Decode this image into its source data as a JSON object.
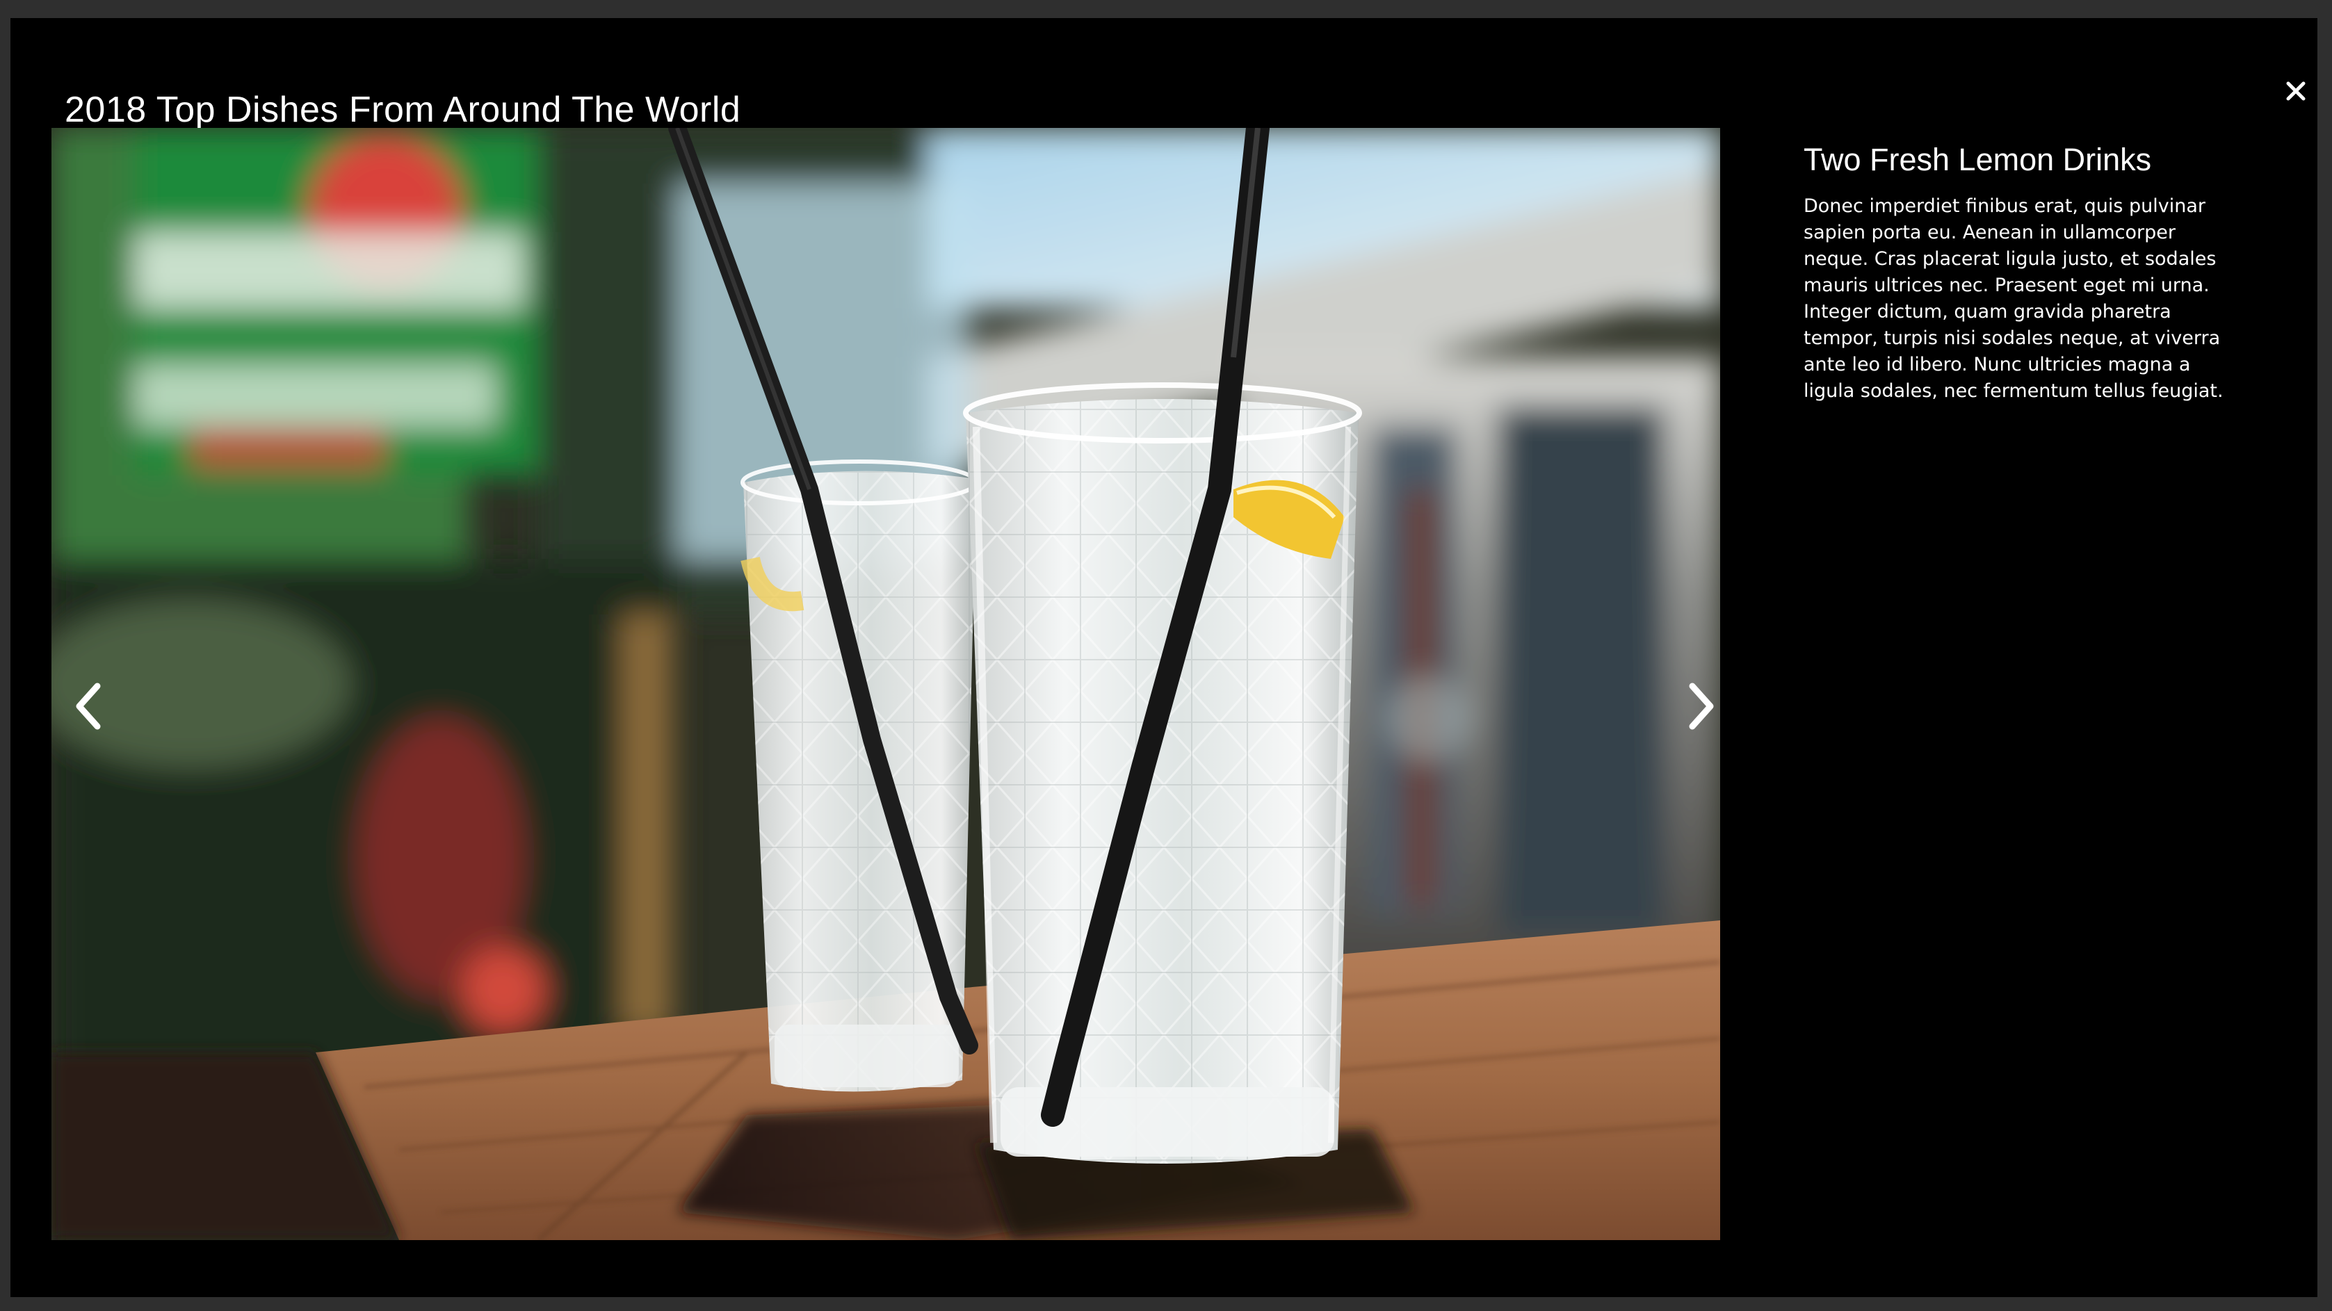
{
  "modal": {
    "title": "2018 Top Dishes From Around The World",
    "close_icon": "close-icon"
  },
  "viewer": {
    "image_alt": "Two glasses of sparkling lemon water with black straws on a wooden table",
    "prev_icon": "chevron-left-icon",
    "next_icon": "chevron-right-icon"
  },
  "info": {
    "title": "Two Fresh Lemon Drinks",
    "description": "Donec imperdiet finibus erat, quis pulvinar sapien porta eu. Aenean in ullamcorper neque. Cras placerat ligula justo, et sodales mauris ultrices nec. Praesent eget mi urna. Integer dictum, quam gravida pharetra tempor, turpis nisi sodales neque, at viverra ante leo id libero. Nunc ultricies magna a ligula sodales, nec fermentum tellus feugiat."
  },
  "colors": {
    "modal_background": "#000000",
    "backdrop": "#2f2f2f",
    "text": "#ffffff"
  }
}
